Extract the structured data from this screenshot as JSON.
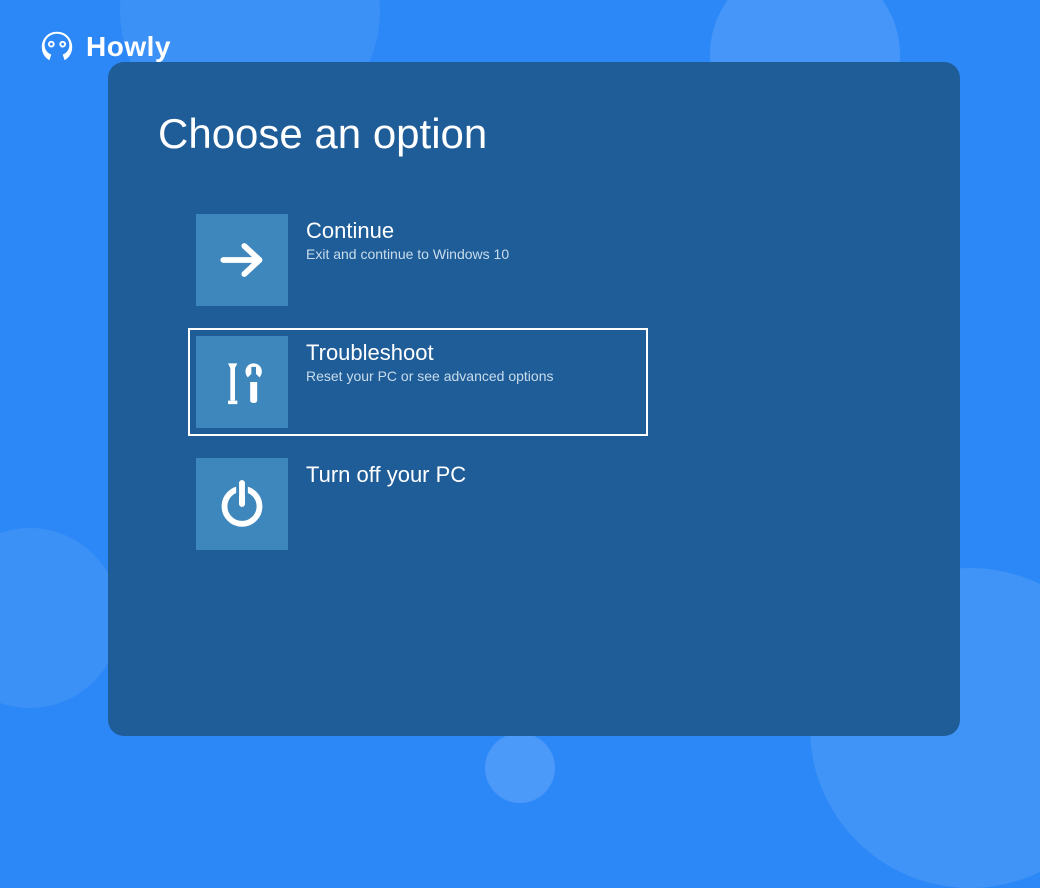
{
  "brand": {
    "name": "Howly"
  },
  "screen": {
    "title": "Choose an option",
    "options": [
      {
        "title": "Continue",
        "desc": "Exit and continue to Windows 10",
        "icon": "arrow-right",
        "selected": false
      },
      {
        "title": "Troubleshoot",
        "desc": "Reset your PC or see advanced options",
        "icon": "tools",
        "selected": true
      },
      {
        "title": "Turn off your PC",
        "desc": "",
        "icon": "power",
        "selected": false
      }
    ]
  }
}
